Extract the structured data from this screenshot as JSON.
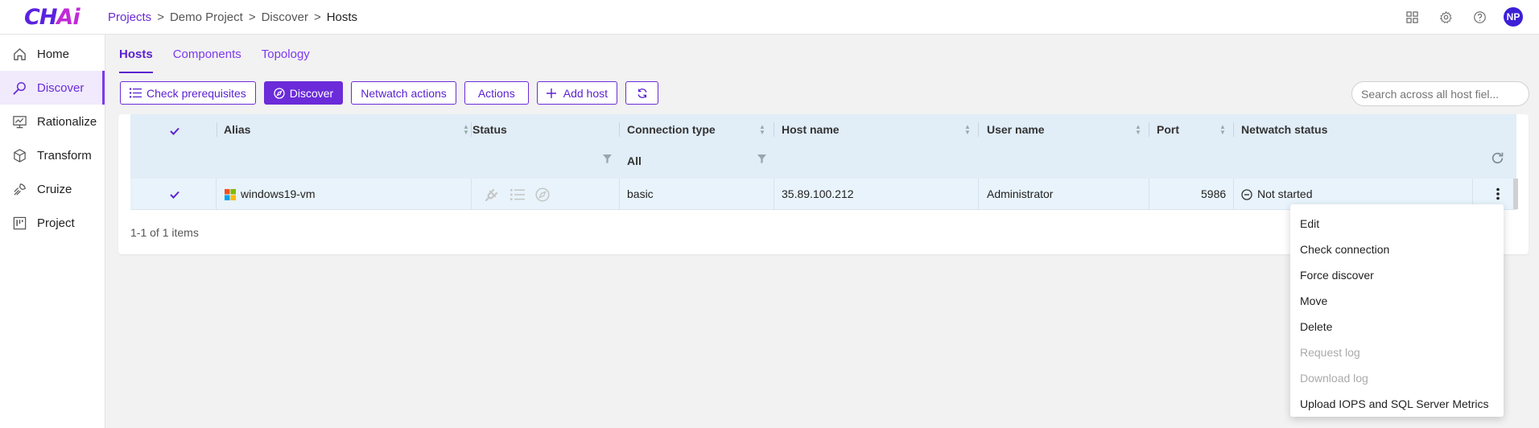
{
  "brand": {
    "logo_main": "CH",
    "logo_ai": "Ai"
  },
  "breadcrumb": [
    "Projects",
    "Demo Project",
    "Discover",
    "Hosts"
  ],
  "breadcrumb_sep": ">",
  "user": {
    "initials": "NP"
  },
  "sidebar": {
    "items": [
      {
        "label": "Home",
        "icon": "home-icon"
      },
      {
        "label": "Discover",
        "icon": "discover-icon",
        "active": true
      },
      {
        "label": "Rationalize",
        "icon": "chart-icon"
      },
      {
        "label": "Transform",
        "icon": "cube-icon"
      },
      {
        "label": "Cruize",
        "icon": "cruize-icon"
      },
      {
        "label": "Project",
        "icon": "kanban-icon"
      }
    ]
  },
  "tabs": [
    {
      "label": "Hosts",
      "active": true
    },
    {
      "label": "Components"
    },
    {
      "label": "Topology"
    }
  ],
  "toolbar": {
    "check_prereq": "Check prerequisites",
    "discover": "Discover",
    "netwatch_actions": "Netwatch actions",
    "actions": "Actions",
    "add_host": "Add host"
  },
  "search": {
    "placeholder": "Search across all host fiel..."
  },
  "table": {
    "columns": [
      "Alias",
      "Status",
      "Connection type",
      "Host name",
      "User name",
      "Port",
      "Netwatch status"
    ],
    "connection_filter": "All",
    "rows": [
      {
        "alias": "windows19-vm",
        "connection_type": "basic",
        "host_name": "35.89.100.212",
        "user_name": "Administrator",
        "port": "5986",
        "netwatch_status": "Not started"
      }
    ],
    "footer": "1-1 of 1 items"
  },
  "context_menu": {
    "items": [
      {
        "label": "Edit",
        "disabled": false
      },
      {
        "label": "Check connection",
        "disabled": false
      },
      {
        "label": "Force discover",
        "disabled": false
      },
      {
        "label": "Move",
        "disabled": false
      },
      {
        "label": "Delete",
        "disabled": false
      },
      {
        "label": "Request log",
        "disabled": true
      },
      {
        "label": "Download log",
        "disabled": true
      },
      {
        "label": "Upload IOPS and SQL Server Metrics",
        "disabled": false
      }
    ]
  },
  "colors": {
    "accent": "#6b2bd9",
    "header_bg": "#e1edf7",
    "row_bg": "#e8f3fb"
  }
}
